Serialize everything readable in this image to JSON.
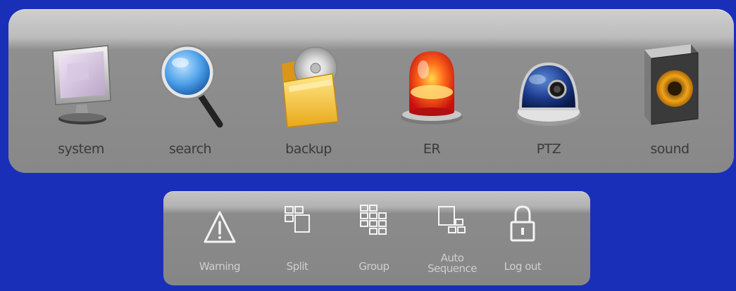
{
  "main_menu": {
    "items": [
      {
        "label": "system",
        "icon": "monitor-icon"
      },
      {
        "label": "search",
        "icon": "magnifier-icon"
      },
      {
        "label": "backup",
        "icon": "folder-disc-icon"
      },
      {
        "label": "ER",
        "icon": "alarm-light-icon"
      },
      {
        "label": "PTZ",
        "icon": "dome-camera-icon"
      },
      {
        "label": "sound",
        "icon": "speaker-icon"
      }
    ]
  },
  "sub_menu": {
    "items": [
      {
        "label": "Warning",
        "icon": "warning-triangle-icon"
      },
      {
        "label": "Split",
        "icon": "split-screen-icon"
      },
      {
        "label": "Group",
        "icon": "group-grid-icon"
      },
      {
        "label_line1": "Auto",
        "label_line2": "Sequence",
        "icon": "auto-sequence-icon"
      },
      {
        "label": "Log out",
        "icon": "padlock-icon"
      }
    ]
  },
  "colors": {
    "background": "#1a2fb8",
    "panel": "#888888",
    "main_label": "#3a3a3a",
    "sub_label": "#cfcfcf"
  }
}
